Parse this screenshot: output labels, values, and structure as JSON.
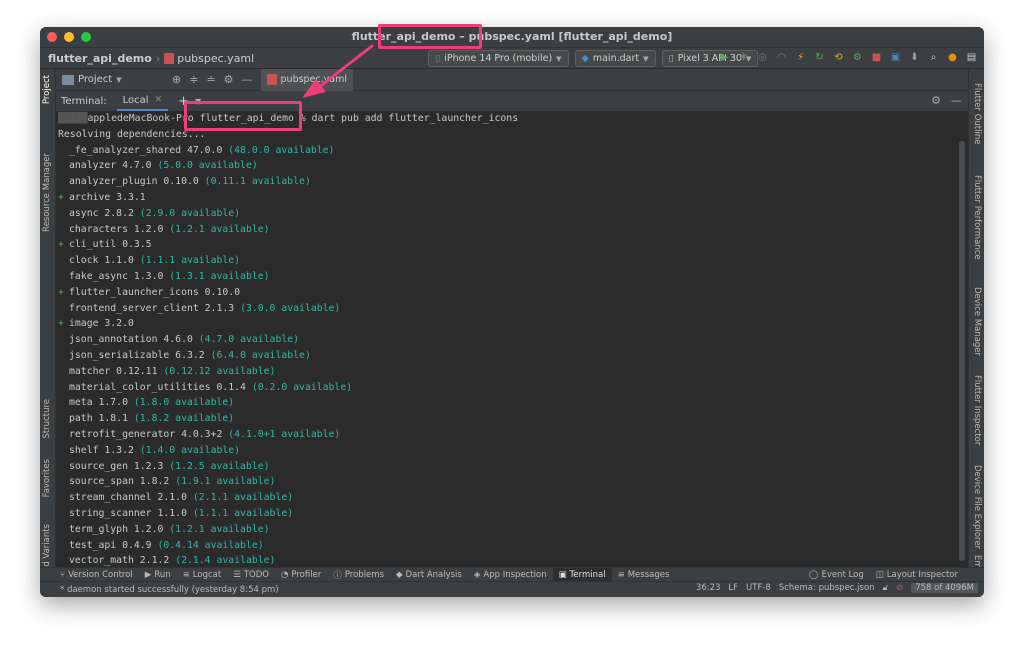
{
  "window": {
    "title": "flutter_api_demo – pubspec.yaml [flutter_api_demo]"
  },
  "navbar": {
    "project": "flutter_api_demo",
    "file": "pubspec.yaml",
    "device_selector": "iPhone 14 Pro (mobile)",
    "run_config": "main.dart",
    "avd_selector": "Pixel 3 API 30"
  },
  "left_strip": [
    "Project",
    "Resource Manager",
    "Structure",
    "Favorites",
    "Build Variants"
  ],
  "right_strip": [
    "Flutter Outline",
    "Flutter Performance",
    "Device Manager",
    "Flutter Inspector",
    "Device File Explorer",
    "Emul"
  ],
  "tool_header": {
    "project_label": "Project",
    "editor_tab": "pubspec.yaml"
  },
  "terminal": {
    "label": "Terminal:",
    "tab": "Local",
    "prompt_user": "appledeMacBook-Pro",
    "prompt_dir": "flutter_api_demo",
    "prompt_cmd": "% dart pub add flutter_launcher_icons",
    "lines": [
      {
        "text": "Resolving dependencies...",
        "mark": "",
        "avail": ""
      },
      {
        "text": "_fe_analyzer_shared 47.0.0",
        "mark": "",
        "avail": "(48.0.0 available)"
      },
      {
        "text": "analyzer 4.7.0",
        "mark": "",
        "avail": "(5.0.0 available)"
      },
      {
        "text": "analyzer_plugin 0.10.0",
        "mark": "",
        "avail": "(0.11.1 available)"
      },
      {
        "text": "archive 3.3.1",
        "mark": "+",
        "avail": ""
      },
      {
        "text": "async 2.8.2",
        "mark": "",
        "avail": "(2.9.0 available)"
      },
      {
        "text": "characters 1.2.0",
        "mark": "",
        "avail": "(1.2.1 available)"
      },
      {
        "text": "cli_util 0.3.5",
        "mark": "+",
        "avail": ""
      },
      {
        "text": "clock 1.1.0",
        "mark": "",
        "avail": "(1.1.1 available)"
      },
      {
        "text": "fake_async 1.3.0",
        "mark": "",
        "avail": "(1.3.1 available)"
      },
      {
        "text": "flutter_launcher_icons 0.10.0",
        "mark": "+",
        "avail": ""
      },
      {
        "text": "frontend_server_client 2.1.3",
        "mark": "",
        "avail": "(3.0.0 available)"
      },
      {
        "text": "image 3.2.0",
        "mark": "+",
        "avail": ""
      },
      {
        "text": "json_annotation 4.6.0",
        "mark": "",
        "avail": "(4.7.0 available)"
      },
      {
        "text": "json_serializable 6.3.2",
        "mark": "",
        "avail": "(6.4.0 available)"
      },
      {
        "text": "matcher 0.12.11",
        "mark": "",
        "avail": "(0.12.12 available)"
      },
      {
        "text": "material_color_utilities 0.1.4",
        "mark": "",
        "avail": "(0.2.0 available)"
      },
      {
        "text": "meta 1.7.0",
        "mark": "",
        "avail": "(1.8.0 available)"
      },
      {
        "text": "path 1.8.1",
        "mark": "",
        "avail": "(1.8.2 available)"
      },
      {
        "text": "retrofit_generator 4.0.3+2",
        "mark": "",
        "avail": "(4.1.0+1 available)"
      },
      {
        "text": "shelf 1.3.2",
        "mark": "",
        "avail": "(1.4.0 available)"
      },
      {
        "text": "source_gen 1.2.3",
        "mark": "",
        "avail": "(1.2.5 available)"
      },
      {
        "text": "source_span 1.8.2",
        "mark": "",
        "avail": "(1.9.1 available)"
      },
      {
        "text": "stream_channel 2.1.0",
        "mark": "",
        "avail": "(2.1.1 available)"
      },
      {
        "text": "string_scanner 1.1.0",
        "mark": "",
        "avail": "(1.1.1 available)"
      },
      {
        "text": "term_glyph 1.2.0",
        "mark": "",
        "avail": "(1.2.1 available)"
      },
      {
        "text": "test_api 0.4.9",
        "mark": "",
        "avail": "(0.4.14 available)"
      },
      {
        "text": "vector_math 2.1.2",
        "mark": "",
        "avail": "(2.1.4 available)"
      }
    ]
  },
  "toolwindows": {
    "left": [
      "Version Control",
      "Run",
      "Logcat",
      "TODO",
      "Profiler",
      "Problems",
      "Dart Analysis",
      "App Inspection",
      "Terminal",
      "Messages"
    ],
    "right": [
      "Event Log",
      "Layout Inspector"
    ],
    "active": "Terminal"
  },
  "status": {
    "message": "* daemon started successfully (yesterday 8:54 pm)",
    "position": "36:23",
    "line_sep": "LF",
    "encoding": "UTF-8",
    "schema": "Schema: pubspec.json",
    "memory": "758 of 4096M"
  },
  "colors": {
    "highlight": "#ec3e78",
    "available": "#2fb7a8",
    "added": "#59a869",
    "background": "#2b2b2b"
  }
}
